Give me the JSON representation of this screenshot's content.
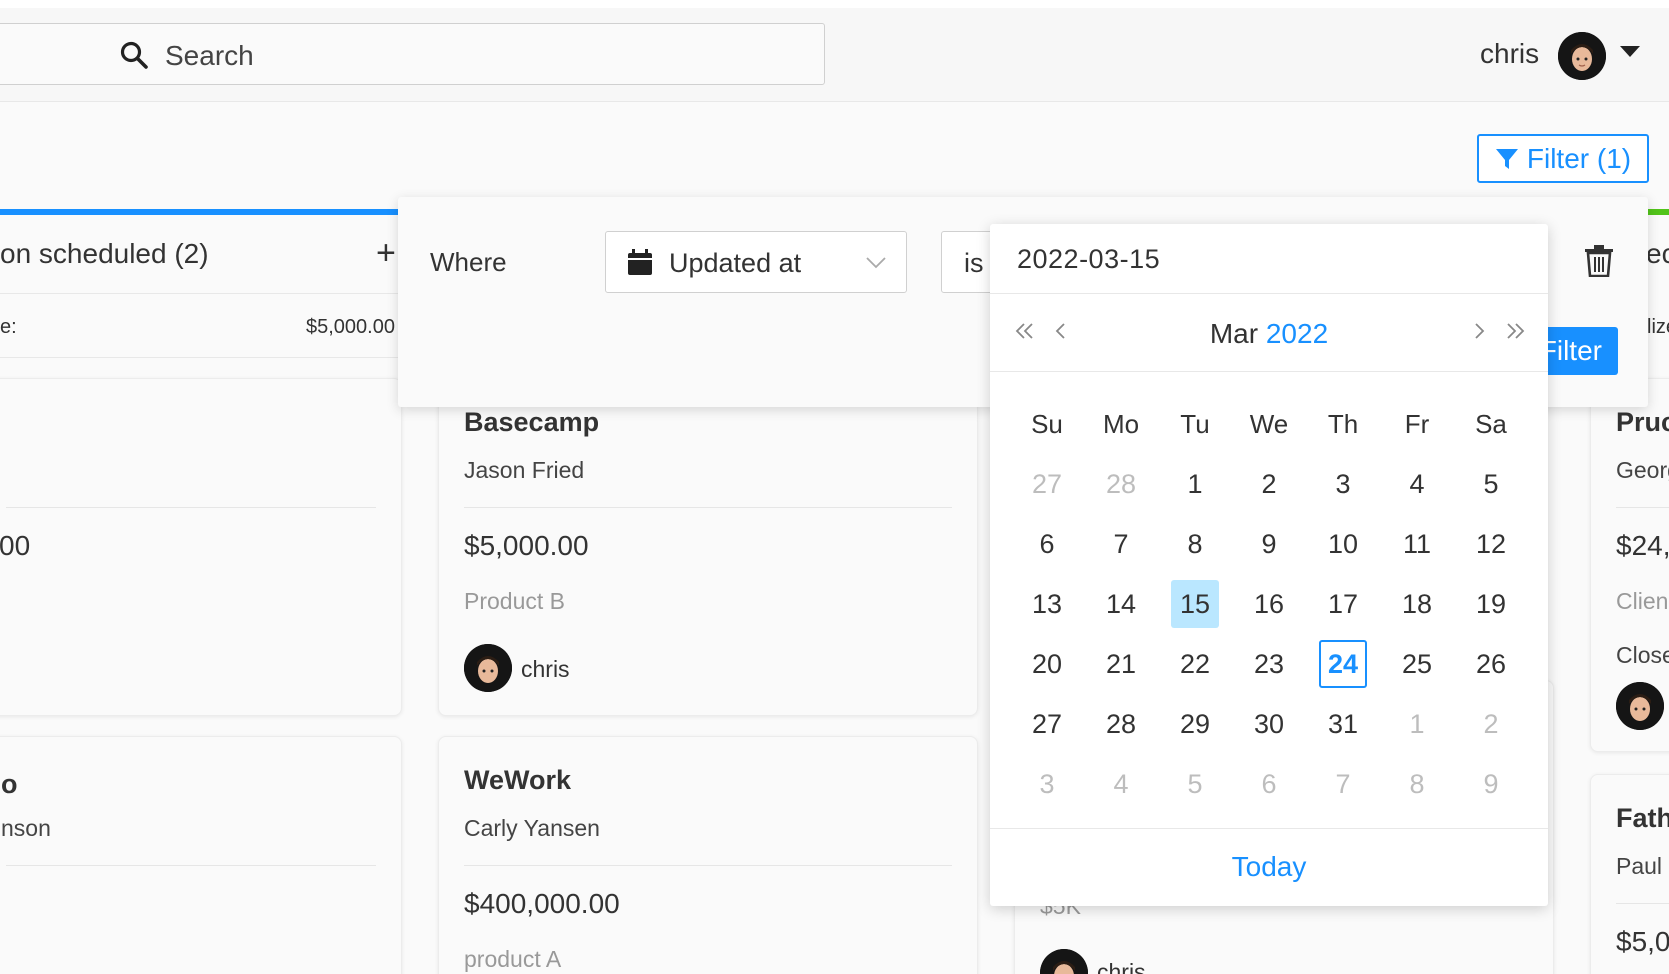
{
  "header": {
    "search_placeholder": "Search",
    "user_name": "chris"
  },
  "toolbar": {
    "filter_label": "Filter (1)"
  },
  "colors": {
    "accent": "#1890ff",
    "selected_day_bg": "#bae7ff",
    "column_bar_blue": "#1890ff",
    "column_bar_green": "#52c41a"
  },
  "columns": {
    "left": {
      "title": "on scheduled (2)",
      "add_symbol": "+",
      "total_label": "e:",
      "total_value": "$5,000.00"
    },
    "right": {
      "title": "ec",
      "total_label": "lize"
    }
  },
  "cards": {
    "left_top": {
      "amount": "00"
    },
    "left_bottom": {
      "title": "o",
      "contact": "nson"
    },
    "basecamp": {
      "title": "Basecamp",
      "contact": "Jason Fried",
      "amount": "$5,000.00",
      "product": "Product B",
      "owner": "chris"
    },
    "wework": {
      "title": "WeWork",
      "contact": "Carly Yansen",
      "amount": "$400,000.00",
      "product": "product A"
    },
    "hidden_mid": {
      "amount": "$5K",
      "owner": "chris"
    },
    "right_top": {
      "title": "Pruc",
      "contact": "Georg",
      "amount": "$24,",
      "product": "Clien",
      "status": "Close"
    },
    "right_bottom": {
      "title": "Fath",
      "contact": "Paul .",
      "amount": "$5,0"
    }
  },
  "filter_popover": {
    "where_label": "Where",
    "field_label": "Updated at",
    "operator_label": "is",
    "apply_label": "Filter"
  },
  "datepicker": {
    "input_value": "2022-03-15",
    "month": "Mar",
    "year": "2022",
    "weekdays": [
      "Su",
      "Mo",
      "Tu",
      "We",
      "Th",
      "Fr",
      "Sa"
    ],
    "weeks": [
      [
        {
          "d": "27",
          "m": true
        },
        {
          "d": "28",
          "m": true
        },
        {
          "d": "1"
        },
        {
          "d": "2"
        },
        {
          "d": "3"
        },
        {
          "d": "4"
        },
        {
          "d": "5"
        }
      ],
      [
        {
          "d": "6"
        },
        {
          "d": "7"
        },
        {
          "d": "8"
        },
        {
          "d": "9"
        },
        {
          "d": "10"
        },
        {
          "d": "11"
        },
        {
          "d": "12"
        }
      ],
      [
        {
          "d": "13"
        },
        {
          "d": "14"
        },
        {
          "d": "15",
          "sel": true
        },
        {
          "d": "16"
        },
        {
          "d": "17"
        },
        {
          "d": "18"
        },
        {
          "d": "19"
        }
      ],
      [
        {
          "d": "20"
        },
        {
          "d": "21"
        },
        {
          "d": "22"
        },
        {
          "d": "23"
        },
        {
          "d": "24",
          "today": true
        },
        {
          "d": "25"
        },
        {
          "d": "26"
        }
      ],
      [
        {
          "d": "27"
        },
        {
          "d": "28"
        },
        {
          "d": "29"
        },
        {
          "d": "30"
        },
        {
          "d": "31"
        },
        {
          "d": "1",
          "m": true
        },
        {
          "d": "2",
          "m": true
        }
      ],
      [
        {
          "d": "3",
          "m": true
        },
        {
          "d": "4",
          "m": true
        },
        {
          "d": "5",
          "m": true
        },
        {
          "d": "6",
          "m": true
        },
        {
          "d": "7",
          "m": true
        },
        {
          "d": "8",
          "m": true
        },
        {
          "d": "9",
          "m": true
        }
      ]
    ],
    "today_label": "Today"
  }
}
